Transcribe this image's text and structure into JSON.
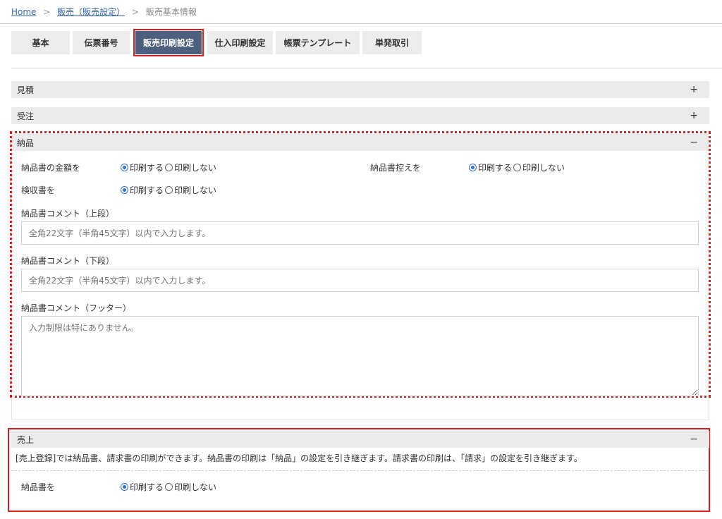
{
  "breadcrumb": {
    "home": "Home",
    "parent": "販売（販売設定）",
    "current": "販売基本情報",
    "separator": ">"
  },
  "tabs": [
    {
      "label": "基本"
    },
    {
      "label": "伝票番号"
    },
    {
      "label": "販売印刷設定"
    },
    {
      "label": "仕入印刷設定"
    },
    {
      "label": "帳票テンプレート"
    },
    {
      "label": "単発取引"
    }
  ],
  "active_tab": "販売印刷設定",
  "sections": {
    "quote": {
      "title": "見積",
      "toggle": "+"
    },
    "order": {
      "title": "受注",
      "toggle": "+"
    },
    "delivery": {
      "title": "納品",
      "toggle": "−",
      "amount_label": "納品書の金額を",
      "copy_label": "納品書控えを",
      "inspection_label": "検収書を",
      "print_yes": "印刷する",
      "print_no": "印刷しない",
      "comment_top_label": "納品書コメント（上段）",
      "comment_top_placeholder": "全角22文字（半角45文字）以内で入力します。",
      "comment_bottom_label": "納品書コメント（下段）",
      "comment_bottom_placeholder": "全角22文字（半角45文字）以内で入力します。",
      "comment_footer_label": "納品書コメント（フッター）",
      "comment_footer_placeholder": "入力制限は特にありません。"
    },
    "sales": {
      "title": "売上",
      "toggle": "−",
      "note": "[売上登録]では納品書、請求書の印刷ができます。納品書の印刷は「納品」の設定を引き継ぎます。請求書の印刷は、「請求」の設定を引き継ぎます。",
      "invoice_label": "納品書を",
      "print_yes": "印刷する",
      "print_no": "印刷しない"
    }
  },
  "colors": {
    "highlight_red": "#e51b1b",
    "active_tab_bg": "#4d5f7e",
    "radio_blue": "#2f6fe0"
  }
}
